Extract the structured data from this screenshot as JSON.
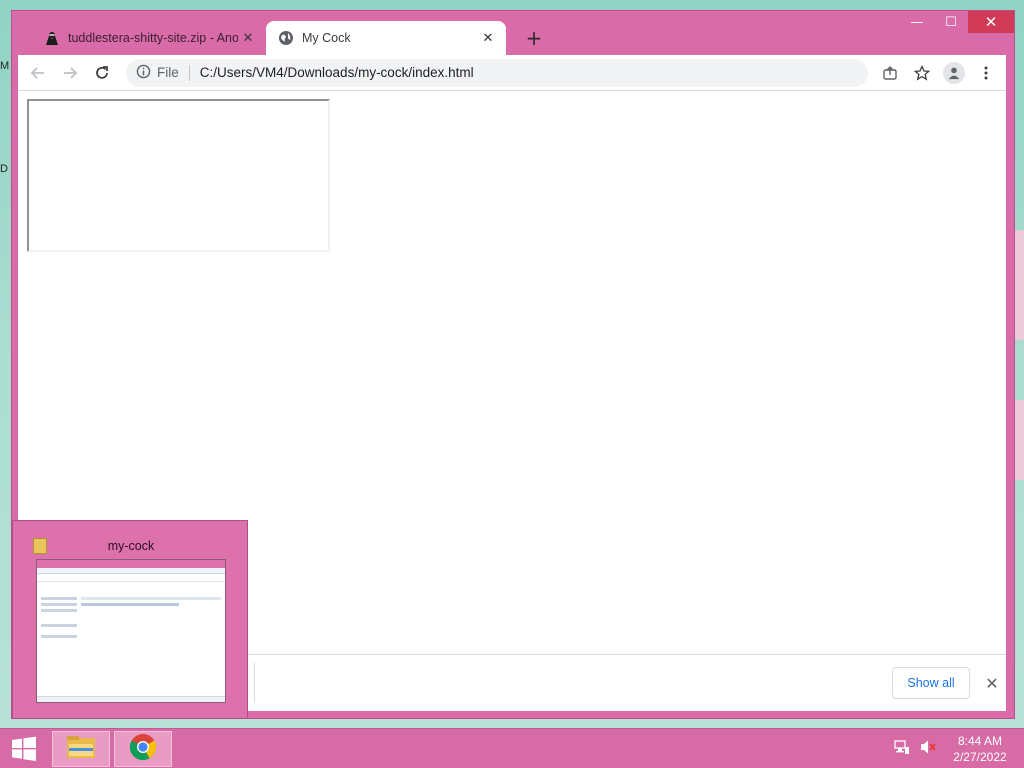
{
  "desktop": {
    "edge_labels": [
      "M",
      "D"
    ]
  },
  "window_controls": {
    "minimize_glyph": "—",
    "maximize_glyph": "☐",
    "close_glyph": "✕"
  },
  "tabs": [
    {
      "title": "tuddlestera-shitty-site.zip - Anon",
      "close_glyph": "✕",
      "icon": "ninja-avatar-icon"
    },
    {
      "title": "My Cock",
      "close_glyph": "✕",
      "icon": "globe-icon"
    }
  ],
  "new_tab_glyph": "+",
  "omnibox": {
    "scheme": "File",
    "url": "C:/Users/VM4/Downloads/my-cock/index.html"
  },
  "download_bar": {
    "show_all_label": "Show all",
    "close_glyph": "✕"
  },
  "taskbar_preview": {
    "title": "my-cock"
  },
  "taskbar": {
    "time": "8:44 AM",
    "date": "2/27/2022"
  }
}
